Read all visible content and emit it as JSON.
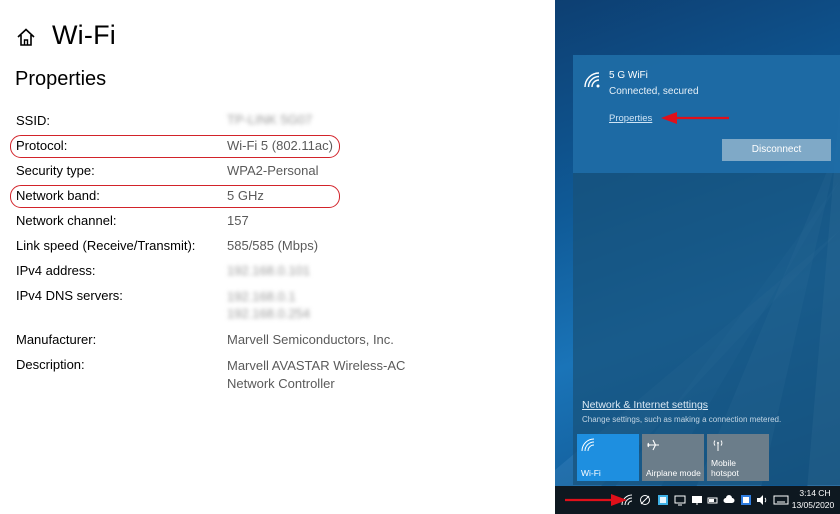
{
  "header": {
    "title": "Wi-Fi",
    "section": "Properties"
  },
  "properties": [
    {
      "label": "SSID:",
      "value": "TP-LINK 5G07",
      "obscured": true
    },
    {
      "label": "Protocol:",
      "value": "Wi-Fi 5 (802.11ac)",
      "highlighted": true
    },
    {
      "label": "Security type:",
      "value": "WPA2-Personal"
    },
    {
      "label": "Network band:",
      "value": "5 GHz",
      "highlighted": true
    },
    {
      "label": "Network channel:",
      "value": "157"
    },
    {
      "label": "Link speed (Receive/Transmit):",
      "value": "585/585 (Mbps)"
    },
    {
      "label": "IPv4 address:",
      "value": "192.168.0.101",
      "obscured": true
    },
    {
      "label": "IPv4 DNS servers:",
      "value": "192.168.0.1",
      "value2": "192.168.0.254",
      "obscured": true
    },
    {
      "label": "Manufacturer:",
      "value": "Marvell Semiconductors, Inc."
    },
    {
      "label": "Description:",
      "value": "Marvell AVASTAR Wireless-AC",
      "value2": "Network Controller"
    }
  ],
  "flyout": {
    "network_name": "5 G WiFi",
    "network_status": "Connected, secured",
    "properties_link": "Properties",
    "disconnect_label": "Disconnect",
    "settings_link": "Network & Internet settings",
    "settings_sub": "Change settings, such as making a connection metered.",
    "tiles": [
      {
        "label": "Wi-Fi",
        "icon": "wifi-icon",
        "active": true
      },
      {
        "label": "Airplane mode",
        "icon": "airplane-icon",
        "active": false
      },
      {
        "label": "Mobile hotspot",
        "label_line1": "Mobile",
        "label_line2": "hotspot",
        "icon": "hotspot-icon",
        "active": false
      }
    ]
  },
  "taskbar": {
    "time": "3:14 CH",
    "date": "13/05/2020"
  },
  "colors": {
    "highlight": "#d2232a",
    "tile_active": "#1e8fe0",
    "arrow": "#e0101a"
  }
}
